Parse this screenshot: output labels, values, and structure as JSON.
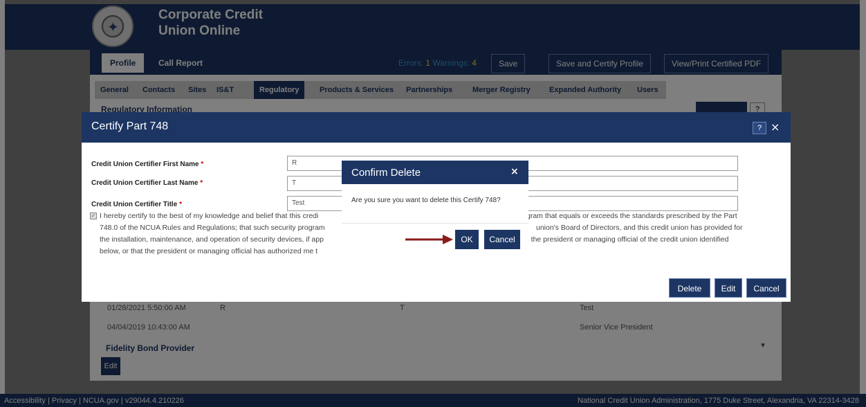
{
  "header": {
    "title_line1": "Corporate Credit",
    "title_line2": "Union Online",
    "logo": "ncua-seal-logo"
  },
  "main_tabs": [
    "Profile",
    "Call Report"
  ],
  "status": {
    "errors_label": "Errors:",
    "errors_count": "1",
    "warnings_label": "Warnings:",
    "warnings_count": "4"
  },
  "header_buttons": {
    "save": "Save",
    "save_certify": "Save and Certify Profile",
    "view_print": "View/Print Certified PDF"
  },
  "sub_tabs": [
    "General",
    "Contacts",
    "Sites",
    "IS&T",
    "Regulatory",
    "Products & Services",
    "Partnerships",
    "Merger Registry",
    "Expanded Authority",
    "Users"
  ],
  "section_title": "Regulatory Information",
  "background_rows": [
    {
      "date": "01/28/2021 5:50:00 AM",
      "first": "R",
      "last": "T",
      "title": "Test"
    },
    {
      "date": "04/04/2019 10:43:00 AM",
      "first": "",
      "last": "",
      "title": "Senior Vice President"
    }
  ],
  "fidelity_bond": {
    "label": "Fidelity Bond Provider",
    "edit": "Edit"
  },
  "footer": {
    "left": "Accessibility | Privacy | NCUA.gov | v29044.4.210226",
    "right": "National Credit Union Administration, 1775 Duke Street, Alexandria, VA 22314-3428"
  },
  "certify_modal": {
    "title": "Certify Part 748",
    "help": "?",
    "close": "×",
    "first_name_label": "Credit Union Certifier First Name",
    "first_name_value": "R",
    "last_name_label": "Credit Union Certifier Last Name",
    "last_name_value": "T",
    "title_label": "Credit Union Certifier Title",
    "title_value": "Test",
    "required_mark": "*",
    "attest_left": "I hereby certify to the best of my knowledge and belief that this credi",
    "attest_right": "gram that equals or exceeds the standards prescribed by the Part",
    "attest_l2_left": "748.0 of the NCUA Rules and Regulations; that such security program",
    "attest_l2_right": "union's Board of Directors, and this credit union has provided for",
    "attest_l3_left": "the installation, maintenance, and operation of security devices, if app",
    "attest_l3_right": "m the president or managing official of the credit union identified",
    "attest_l4": "below, or that the president or managing official has authorized me t",
    "buttons": {
      "delete": "Delete",
      "edit": "Edit",
      "cancel": "Cancel"
    }
  },
  "confirm_dialog": {
    "title": "Confirm Delete",
    "close": "×",
    "message": "Are you sure you want to delete this Certify 748?",
    "ok": "OK",
    "cancel": "Cancel"
  },
  "colors": {
    "navy": "#1c3563",
    "arrow": "#8b1a1a",
    "required": "#d00000"
  }
}
